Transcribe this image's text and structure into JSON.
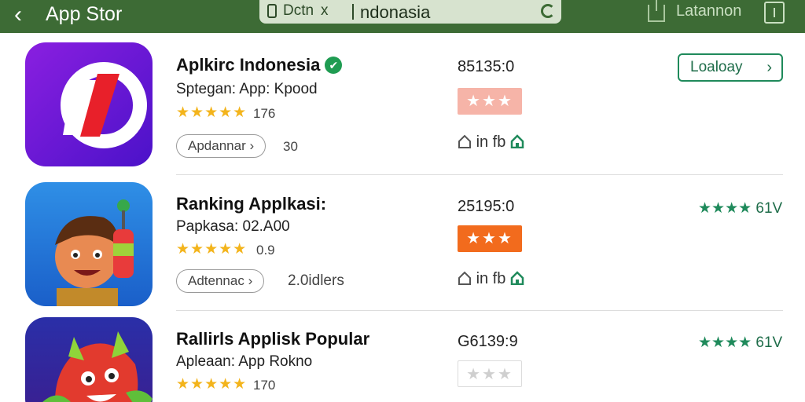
{
  "topbar": {
    "title": "App Stor",
    "search_query_left": "Dctn",
    "search_x": "x",
    "search_query": "ndonasia",
    "language": "Latannon"
  },
  "apps": [
    {
      "name": "Aplkirc Indonesia",
      "verified": true,
      "subtitle": "Sptegan: App: Kpood",
      "stars": "★★★★★",
      "rating_count": "176",
      "pill_label": "Apdannar",
      "pill_extra": "30",
      "downloads": "85135:0",
      "rating_box": "★★★",
      "rating_box_color": "#f6b4a8",
      "socials": "in fb",
      "action_label": "Loaloay",
      "right_stars": "",
      "right_count": ""
    },
    {
      "name": "Ranking Applkasi:",
      "verified": false,
      "subtitle": "Papkasa: 02.A00",
      "stars": "★★★★★",
      "rating_count": "0.9",
      "pill_label": "Adtennac",
      "pill_extra": "2.0idlers",
      "downloads": "25195:0",
      "rating_box": "★★★",
      "rating_box_color": "#f26b1d",
      "socials": "in fb",
      "action_label": "",
      "right_stars": "★★★★",
      "right_count": "61V"
    },
    {
      "name": "Rallirls Applisk Popular",
      "verified": false,
      "subtitle": "Apleaan: App Rokno",
      "stars": "★★★★★",
      "rating_count": "170",
      "pill_label": "",
      "pill_extra": "",
      "downloads": "G6139:9",
      "rating_box": "★★★",
      "rating_box_color": "#ffffff",
      "socials": "",
      "action_label": "",
      "right_stars": "★★★★",
      "right_count": "61V"
    }
  ]
}
